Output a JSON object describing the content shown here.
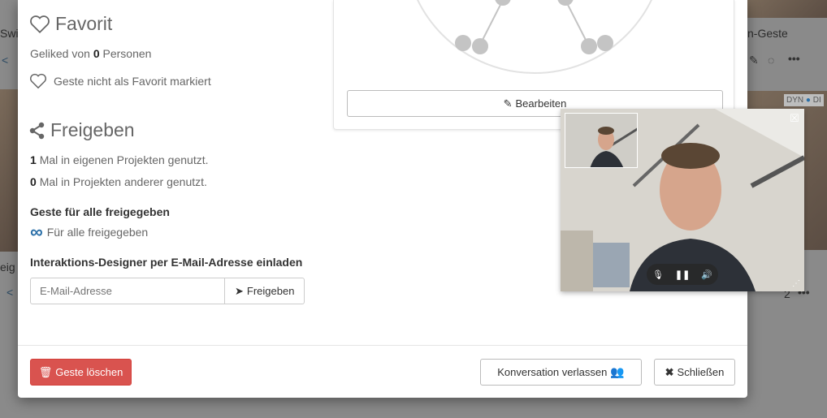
{
  "background": {
    "left_texts": [
      "Swi",
      "eig"
    ],
    "right_texts": [
      "n-Geste"
    ],
    "badges": [
      "DYN",
      "DI"
    ],
    "count": "2"
  },
  "favorit": {
    "title": "Favorit",
    "liked_prefix": "Geliked von",
    "liked_count": "0",
    "liked_suffix": "Personen",
    "status": "Geste nicht als Favorit markiert"
  },
  "freigeben": {
    "title": "Freigeben",
    "own_count": "1",
    "own_text": "Mal in eigenen Projekten genutzt.",
    "other_count": "0",
    "other_text": "Mal in Projekten anderer genutzt.",
    "all_label": "Geste für alle freigegeben",
    "all_status": "Für alle freigegeben",
    "invite_label": "Interaktions-Designer per E-Mail-Adresse einladen",
    "email_placeholder": "E-Mail-Adresse",
    "share_button": "Freigeben"
  },
  "graph": {
    "edit_button": "Bearbeiten"
  },
  "footer": {
    "delete_button": "Geste löschen",
    "leave_button": "Konversation verlassen",
    "close_button": "Schließen"
  },
  "colors": {
    "danger": "#d9534f",
    "accent": "#2a6fa8"
  }
}
